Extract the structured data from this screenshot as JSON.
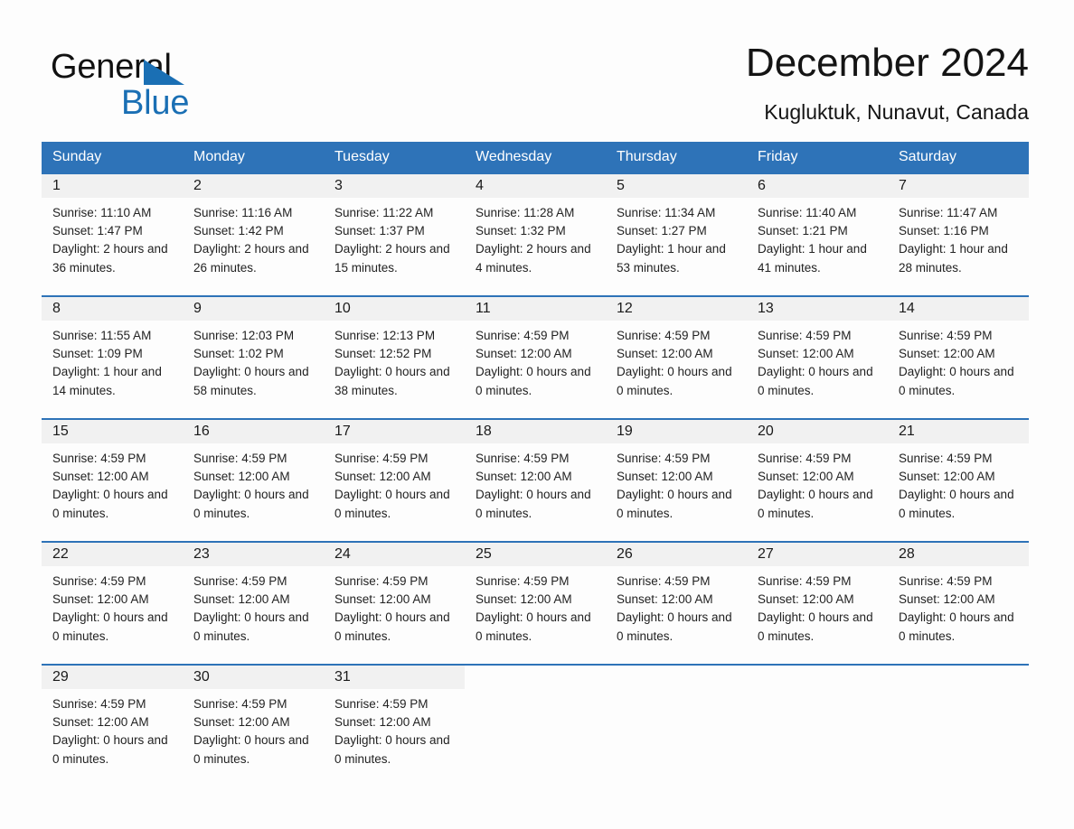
{
  "brand": {
    "name_part1": "General",
    "name_part2": "Blue",
    "accent_color": "#1a6fb4"
  },
  "header": {
    "title": "December 2024",
    "subtitle": "Kugluktuk, Nunavut, Canada"
  },
  "theme": {
    "header_bg": "#2e73b8",
    "daynum_bg": "#f1f1f1",
    "page_bg": "#fdfdfd",
    "text": "#1a1a1a"
  },
  "weekday_headers": [
    "Sunday",
    "Monday",
    "Tuesday",
    "Wednesday",
    "Thursday",
    "Friday",
    "Saturday"
  ],
  "weeks": [
    [
      {
        "day": "1",
        "sunrise": "Sunrise: 11:10 AM",
        "sunset": "Sunset: 1:47 PM",
        "daylight": "Daylight: 2 hours and 36 minutes."
      },
      {
        "day": "2",
        "sunrise": "Sunrise: 11:16 AM",
        "sunset": "Sunset: 1:42 PM",
        "daylight": "Daylight: 2 hours and 26 minutes."
      },
      {
        "day": "3",
        "sunrise": "Sunrise: 11:22 AM",
        "sunset": "Sunset: 1:37 PM",
        "daylight": "Daylight: 2 hours and 15 minutes."
      },
      {
        "day": "4",
        "sunrise": "Sunrise: 11:28 AM",
        "sunset": "Sunset: 1:32 PM",
        "daylight": "Daylight: 2 hours and 4 minutes."
      },
      {
        "day": "5",
        "sunrise": "Sunrise: 11:34 AM",
        "sunset": "Sunset: 1:27 PM",
        "daylight": "Daylight: 1 hour and 53 minutes."
      },
      {
        "day": "6",
        "sunrise": "Sunrise: 11:40 AM",
        "sunset": "Sunset: 1:21 PM",
        "daylight": "Daylight: 1 hour and 41 minutes."
      },
      {
        "day": "7",
        "sunrise": "Sunrise: 11:47 AM",
        "sunset": "Sunset: 1:16 PM",
        "daylight": "Daylight: 1 hour and 28 minutes."
      }
    ],
    [
      {
        "day": "8",
        "sunrise": "Sunrise: 11:55 AM",
        "sunset": "Sunset: 1:09 PM",
        "daylight": "Daylight: 1 hour and 14 minutes."
      },
      {
        "day": "9",
        "sunrise": "Sunrise: 12:03 PM",
        "sunset": "Sunset: 1:02 PM",
        "daylight": "Daylight: 0 hours and 58 minutes."
      },
      {
        "day": "10",
        "sunrise": "Sunrise: 12:13 PM",
        "sunset": "Sunset: 12:52 PM",
        "daylight": "Daylight: 0 hours and 38 minutes."
      },
      {
        "day": "11",
        "sunrise": "Sunrise: 4:59 PM",
        "sunset": "Sunset: 12:00 AM",
        "daylight": "Daylight: 0 hours and 0 minutes."
      },
      {
        "day": "12",
        "sunrise": "Sunrise: 4:59 PM",
        "sunset": "Sunset: 12:00 AM",
        "daylight": "Daylight: 0 hours and 0 minutes."
      },
      {
        "day": "13",
        "sunrise": "Sunrise: 4:59 PM",
        "sunset": "Sunset: 12:00 AM",
        "daylight": "Daylight: 0 hours and 0 minutes."
      },
      {
        "day": "14",
        "sunrise": "Sunrise: 4:59 PM",
        "sunset": "Sunset: 12:00 AM",
        "daylight": "Daylight: 0 hours and 0 minutes."
      }
    ],
    [
      {
        "day": "15",
        "sunrise": "Sunrise: 4:59 PM",
        "sunset": "Sunset: 12:00 AM",
        "daylight": "Daylight: 0 hours and 0 minutes."
      },
      {
        "day": "16",
        "sunrise": "Sunrise: 4:59 PM",
        "sunset": "Sunset: 12:00 AM",
        "daylight": "Daylight: 0 hours and 0 minutes."
      },
      {
        "day": "17",
        "sunrise": "Sunrise: 4:59 PM",
        "sunset": "Sunset: 12:00 AM",
        "daylight": "Daylight: 0 hours and 0 minutes."
      },
      {
        "day": "18",
        "sunrise": "Sunrise: 4:59 PM",
        "sunset": "Sunset: 12:00 AM",
        "daylight": "Daylight: 0 hours and 0 minutes."
      },
      {
        "day": "19",
        "sunrise": "Sunrise: 4:59 PM",
        "sunset": "Sunset: 12:00 AM",
        "daylight": "Daylight: 0 hours and 0 minutes."
      },
      {
        "day": "20",
        "sunrise": "Sunrise: 4:59 PM",
        "sunset": "Sunset: 12:00 AM",
        "daylight": "Daylight: 0 hours and 0 minutes."
      },
      {
        "day": "21",
        "sunrise": "Sunrise: 4:59 PM",
        "sunset": "Sunset: 12:00 AM",
        "daylight": "Daylight: 0 hours and 0 minutes."
      }
    ],
    [
      {
        "day": "22",
        "sunrise": "Sunrise: 4:59 PM",
        "sunset": "Sunset: 12:00 AM",
        "daylight": "Daylight: 0 hours and 0 minutes."
      },
      {
        "day": "23",
        "sunrise": "Sunrise: 4:59 PM",
        "sunset": "Sunset: 12:00 AM",
        "daylight": "Daylight: 0 hours and 0 minutes."
      },
      {
        "day": "24",
        "sunrise": "Sunrise: 4:59 PM",
        "sunset": "Sunset: 12:00 AM",
        "daylight": "Daylight: 0 hours and 0 minutes."
      },
      {
        "day": "25",
        "sunrise": "Sunrise: 4:59 PM",
        "sunset": "Sunset: 12:00 AM",
        "daylight": "Daylight: 0 hours and 0 minutes."
      },
      {
        "day": "26",
        "sunrise": "Sunrise: 4:59 PM",
        "sunset": "Sunset: 12:00 AM",
        "daylight": "Daylight: 0 hours and 0 minutes."
      },
      {
        "day": "27",
        "sunrise": "Sunrise: 4:59 PM",
        "sunset": "Sunset: 12:00 AM",
        "daylight": "Daylight: 0 hours and 0 minutes."
      },
      {
        "day": "28",
        "sunrise": "Sunrise: 4:59 PM",
        "sunset": "Sunset: 12:00 AM",
        "daylight": "Daylight: 0 hours and 0 minutes."
      }
    ],
    [
      {
        "day": "29",
        "sunrise": "Sunrise: 4:59 PM",
        "sunset": "Sunset: 12:00 AM",
        "daylight": "Daylight: 0 hours and 0 minutes."
      },
      {
        "day": "30",
        "sunrise": "Sunrise: 4:59 PM",
        "sunset": "Sunset: 12:00 AM",
        "daylight": "Daylight: 0 hours and 0 minutes."
      },
      {
        "day": "31",
        "sunrise": "Sunrise: 4:59 PM",
        "sunset": "Sunset: 12:00 AM",
        "daylight": "Daylight: 0 hours and 0 minutes."
      },
      {
        "day": "",
        "sunrise": "",
        "sunset": "",
        "daylight": ""
      },
      {
        "day": "",
        "sunrise": "",
        "sunset": "",
        "daylight": ""
      },
      {
        "day": "",
        "sunrise": "",
        "sunset": "",
        "daylight": ""
      },
      {
        "day": "",
        "sunrise": "",
        "sunset": "",
        "daylight": ""
      }
    ]
  ]
}
